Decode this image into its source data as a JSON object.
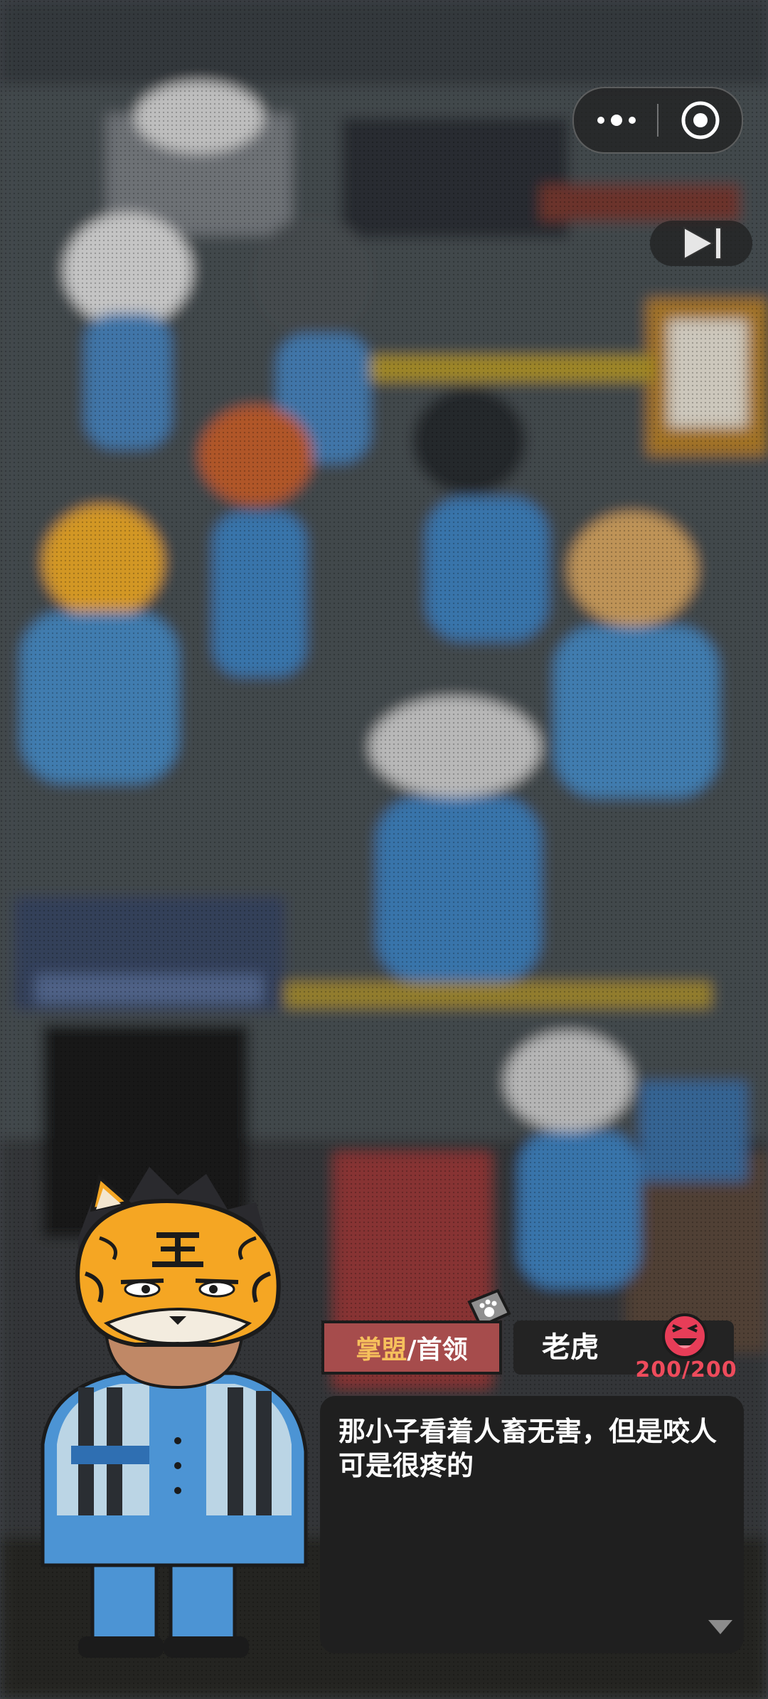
{
  "capsule": {
    "more_icon": "more-dots-icon",
    "close_icon": "target-circle-icon"
  },
  "skip": {
    "icon": "skip-forward-icon"
  },
  "dialogue": {
    "role_label": "掌盟",
    "title_rest": "/首领",
    "speaker": "老虎",
    "hp": "200/200",
    "text": "那小子看着人畜无害，但是咬人可是很疼的",
    "next_icon": "down-triangle-icon",
    "hp_icon": "laughing-face-icon",
    "badge_icon": "paw-badge-icon"
  },
  "colors": {
    "accent_red": "#ee4b5c",
    "title_bg": "#a64c4c",
    "role_gold": "#f6c05c",
    "panel_dark": "#1f1f1f",
    "uniform_blue": "#4a90d0",
    "tiger_orange": "#f5a623"
  }
}
